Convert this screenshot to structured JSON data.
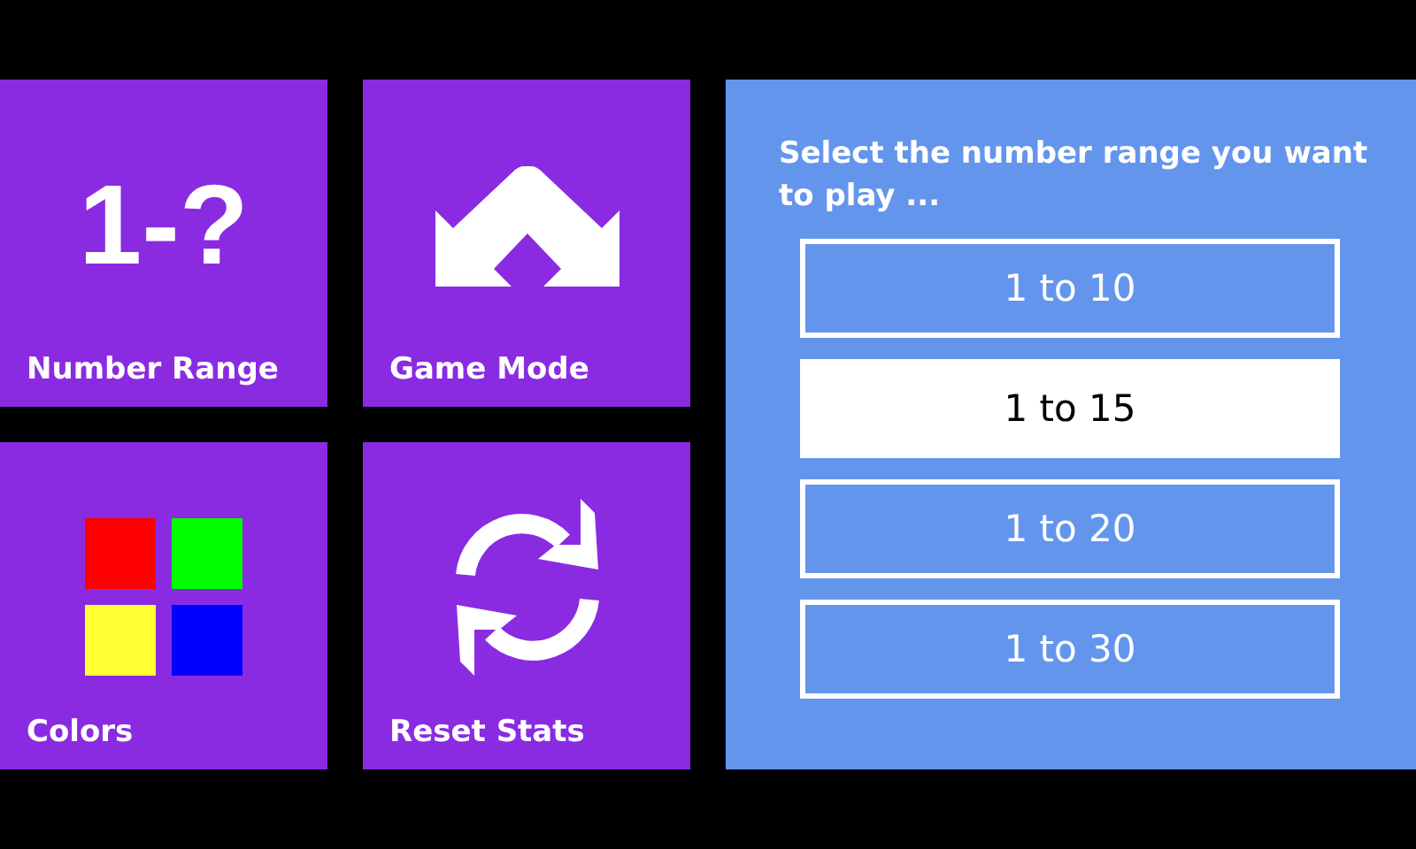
{
  "tiles": [
    {
      "kind": "glyph",
      "glyph": "1-?",
      "label": "Number Range"
    },
    {
      "kind": "mode",
      "label": "Game Mode"
    },
    {
      "kind": "swatches",
      "label": "Colors",
      "swatches": [
        {
          "color": "#ff0000"
        },
        {
          "color": "#00ff00"
        },
        {
          "color": "#ffff33"
        },
        {
          "color": "#0000ff"
        }
      ]
    },
    {
      "kind": "reset",
      "label": "Reset Stats"
    }
  ],
  "panel": {
    "prompt": "Select the number range you want to play ...",
    "options": [
      {
        "label": "1 to 10",
        "selected": false
      },
      {
        "label": "1 to 15",
        "selected": true
      },
      {
        "label": "1 to 20",
        "selected": false
      },
      {
        "label": "1 to 30",
        "selected": false
      }
    ]
  }
}
